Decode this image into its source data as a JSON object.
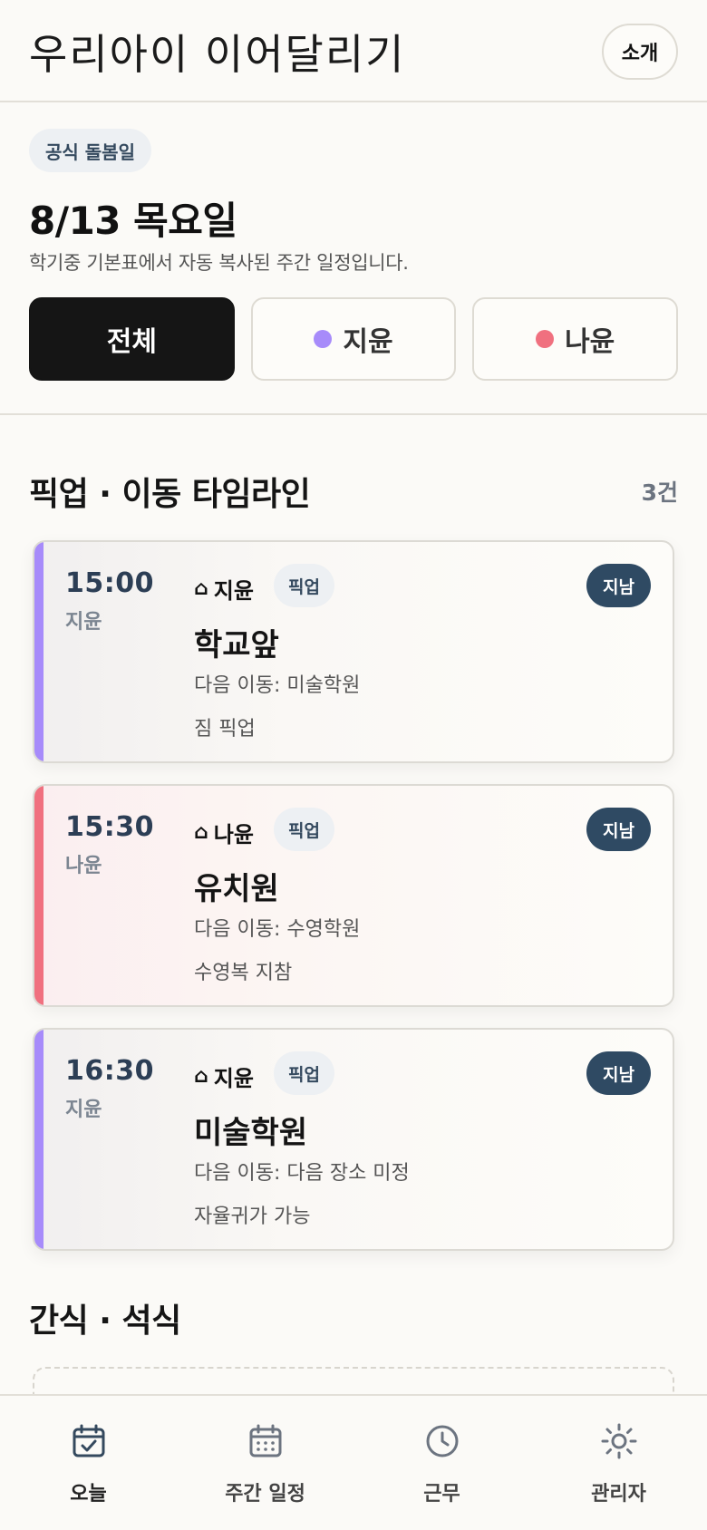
{
  "header": {
    "title": "우리아이 이어달리기",
    "about_label": "소개"
  },
  "day": {
    "badge": "공식 돌봄일",
    "date": "8/13 목요일",
    "subtitle": "학기중 기본표에서 자동 복사된 주간 일정입니다."
  },
  "filters": [
    {
      "label": "전체",
      "active": true
    },
    {
      "label": "지윤",
      "dot_color": "#a78bfa"
    },
    {
      "label": "나윤",
      "dot_color": "#f0707f"
    }
  ],
  "timeline": {
    "title": "픽업 · 이동 타임라인",
    "count": "3건",
    "items": [
      {
        "time": "15:00",
        "child": "지윤",
        "type": "픽업",
        "status": "지남",
        "place": "학교앞",
        "next": "다음 이동: 미술학원",
        "note": "짐 픽업",
        "color": "#a78bfa"
      },
      {
        "time": "15:30",
        "child": "나윤",
        "type": "픽업",
        "status": "지남",
        "place": "유치원",
        "next": "다음 이동: 수영학원",
        "note": "수영복 지참",
        "color": "#f0707f"
      },
      {
        "time": "16:30",
        "child": "지윤",
        "type": "픽업",
        "status": "지남",
        "place": "미술학원",
        "next": "다음 이동: 다음 장소 미정",
        "note": "자율귀가 가능",
        "color": "#a78bfa"
      }
    ]
  },
  "snack": {
    "title": "간식 · 석식"
  },
  "bottom_nav": [
    {
      "label": "오늘",
      "icon": "calendar-check-icon",
      "active": true
    },
    {
      "label": "주간 일정",
      "icon": "calendar-grid-icon"
    },
    {
      "label": "근무",
      "icon": "clock-icon"
    },
    {
      "label": "관리자",
      "icon": "sun-gear-icon"
    }
  ],
  "home_glyph": "⌂"
}
